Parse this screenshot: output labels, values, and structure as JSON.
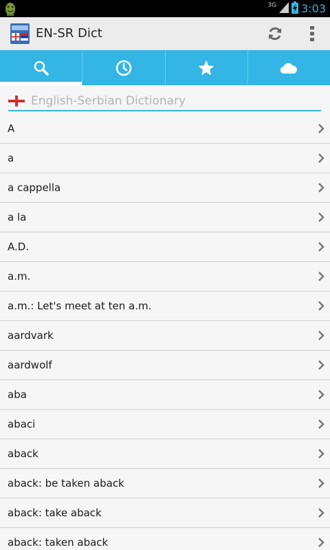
{
  "status_bar": {
    "network": "3G",
    "time": "3:03"
  },
  "action_bar": {
    "title": "EN-SR Dict"
  },
  "tabs": [
    {
      "name": "search",
      "icon": "search-icon",
      "active": true
    },
    {
      "name": "history",
      "icon": "clock-icon",
      "active": false
    },
    {
      "name": "favorites",
      "icon": "star-icon",
      "active": false
    },
    {
      "name": "cloud",
      "icon": "cloud-icon",
      "active": false
    }
  ],
  "search": {
    "value": "",
    "placeholder": "English-Serbian Dictionary"
  },
  "words": [
    "A",
    "a",
    "a cappella",
    "a la",
    "A.D.",
    "a.m.",
    "a.m.: Let's meet at ten a.m.",
    "aardvark",
    "aardwolf",
    "aba",
    "abaci",
    "aback",
    "aback: be taken aback",
    "aback: take aback",
    "aback: taken aback"
  ],
  "colors": {
    "accent": "#33b5e5",
    "status_bar": "#000000",
    "action_bar": "#ececec",
    "clock": "#33b5e5"
  }
}
